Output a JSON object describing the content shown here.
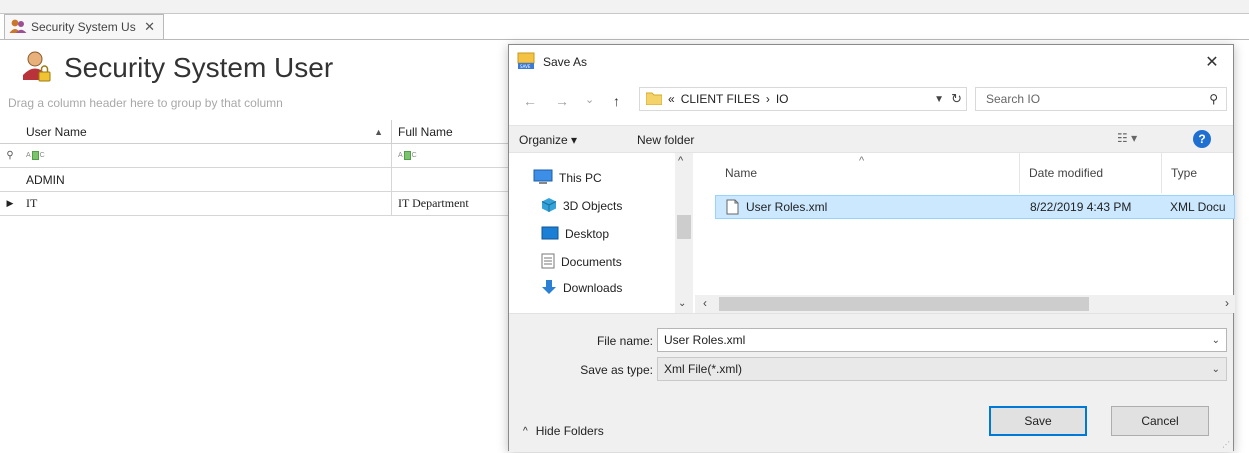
{
  "app": {
    "doc_tab_label": "Security System Us",
    "doc_tab_close": "✕",
    "view_title": "Security System User",
    "group_panel_hint": "Drag a column header here to group by that column",
    "grid": {
      "columns": [
        "User Name",
        "Full Name"
      ],
      "sort_indicator": "▲",
      "rows": [
        {
          "user_name": "ADMIN",
          "full_name": ""
        },
        {
          "user_name": "IT",
          "full_name": "IT Department"
        }
      ]
    }
  },
  "dialog": {
    "title": "Save As",
    "close_glyph": "✕",
    "nav": {
      "back": "←",
      "forward": "→",
      "recent": "⌄",
      "up": "↑"
    },
    "address": {
      "prefix": "«",
      "path": [
        "CLIENT FILES",
        "IO"
      ],
      "separator": "›"
    },
    "search_placeholder": "Search IO",
    "toolbar": {
      "organize": "Organize ▾",
      "new_folder": "New folder",
      "view": "☷ ▾",
      "help": "?"
    },
    "nav_pane": [
      "This PC",
      "3D Objects",
      "Desktop",
      "Documents",
      "Downloads"
    ],
    "file_list": {
      "columns": [
        "Name",
        "Date modified",
        "Type"
      ],
      "rows": [
        {
          "name": "User Roles.xml",
          "date_modified": "8/22/2019 4:43 PM",
          "type": "XML Docu"
        }
      ]
    },
    "file_name_label": "File name:",
    "file_name_value": "User Roles.xml",
    "save_type_label": "Save as type:",
    "save_type_value": "Xml File(*.xml)",
    "hide_folders": "Hide Folders",
    "save_button": "Save",
    "cancel_button": "Cancel"
  },
  "colors": {
    "accent": "#0078d7",
    "selection": "#cce8ff",
    "help": "#1f6fd1"
  }
}
